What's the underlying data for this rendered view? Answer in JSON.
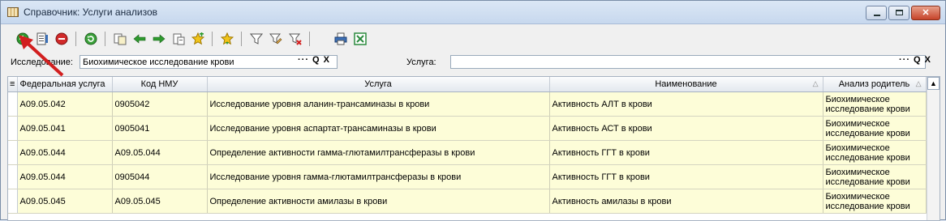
{
  "window": {
    "title": "Справочник: Услуги анализов",
    "buttons": {
      "minimize": "minimize",
      "maximize": "maximize",
      "close": "close"
    }
  },
  "toolbar": {
    "icons": [
      "add-icon",
      "properties-icon",
      "delete-icon",
      "refresh-icon",
      "copy-icon",
      "back-arrow-icon",
      "forward-arrow-icon",
      "paste-icon",
      "star-add-icon",
      "star-down-icon",
      "filter-icon",
      "filter-edit-icon",
      "filter-clear-icon",
      "print-icon",
      "excel-icon"
    ]
  },
  "filters": {
    "research_label": "Исследование:",
    "research_value": "Биохимическое исследование крови",
    "research_buttons": "··· Q X",
    "service_label": "Услуга:",
    "service_value": "",
    "service_buttons": "··· Q X"
  },
  "table": {
    "headers": [
      "Федеральная услуга",
      "Код НМУ",
      "Услуга",
      "Наименование",
      "Анализ родитель"
    ],
    "rows": [
      [
        "A09.05.042",
        "0905042",
        "Исследование уровня аланин-трансаминазы в крови",
        "Активность АЛТ в крови",
        "Биохимическое исследование крови"
      ],
      [
        "A09.05.041",
        "0905041",
        "Исследование уровня аспартат-трансаминазы в крови",
        "Активность АСТ в крови",
        "Биохимическое исследование крови"
      ],
      [
        "A09.05.044",
        "A09.05.044",
        "Определение активности гамма-глютамилтрансферазы в крови",
        "Активность ГГТ в крови",
        "Биохимическое исследование крови"
      ],
      [
        "A09.05.044",
        "0905044",
        "Исследование уровня гамма-глютамилтрансферазы в крови",
        "Активность ГГТ в крови",
        "Биохимическое исследование крови"
      ],
      [
        "A09.05.045",
        "A09.05.045",
        "Определение активности амилазы в крови",
        "Активность амилазы в крови",
        "Биохимическое исследование крови"
      ]
    ]
  },
  "colors": {
    "row_bg": "#fdfdd8",
    "accent_red": "#d21f1f",
    "title_bg": "#c7d8ee"
  }
}
